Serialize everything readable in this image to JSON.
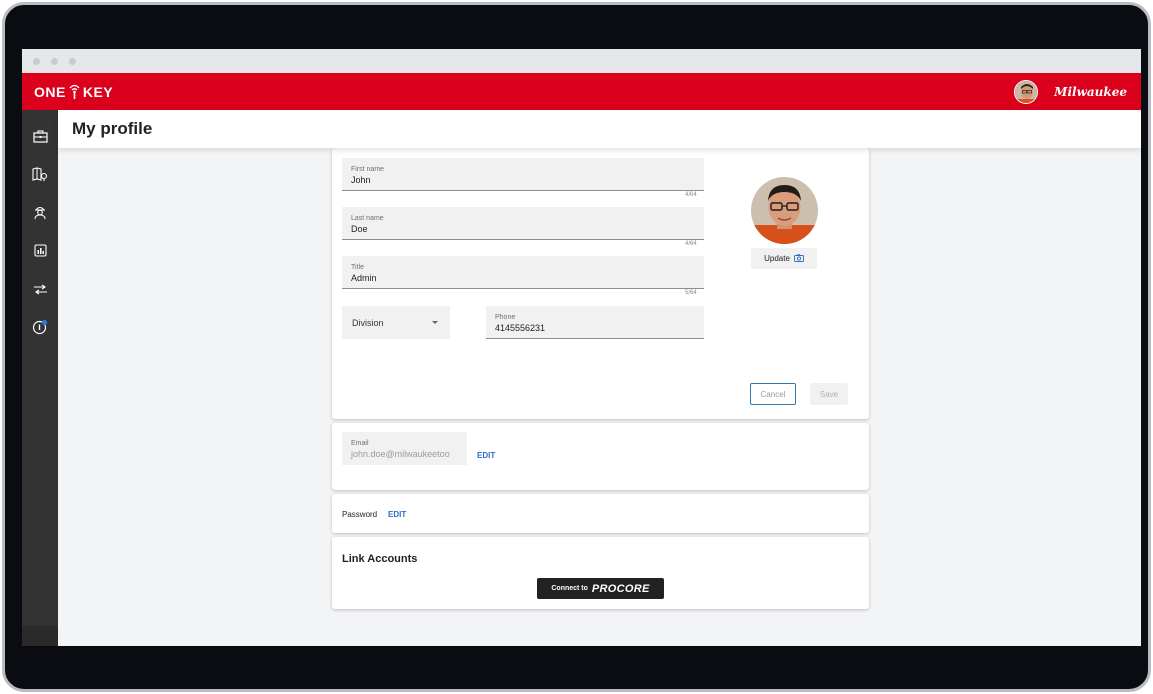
{
  "app": {
    "logo_text_left": "ONE",
    "logo_text_right": "KEY",
    "brand": "Milwaukee"
  },
  "header": {
    "title": "My profile"
  },
  "sidebar": {
    "items": [
      {
        "icon": "toolbox-icon"
      },
      {
        "icon": "map-pin-icon"
      },
      {
        "icon": "worker-icon"
      },
      {
        "icon": "report-icon"
      },
      {
        "icon": "transfer-icon"
      },
      {
        "icon": "info-icon"
      }
    ]
  },
  "profile": {
    "first_name": {
      "label": "First name",
      "value": "John",
      "counter": "4/64"
    },
    "last_name": {
      "label": "Last name",
      "value": "Doe",
      "counter": "4/64"
    },
    "title": {
      "label": "Title",
      "value": "Admin",
      "counter": "5/64"
    },
    "division": {
      "label": "Division"
    },
    "phone": {
      "label": "Phone",
      "value": "4145556231"
    },
    "update_label": "Update",
    "cancel_label": "Cancel",
    "save_label": "Save"
  },
  "email": {
    "label": "Email",
    "value": "john.doe@milwaukeetoo",
    "edit_label": "EDIT"
  },
  "password": {
    "label": "Password",
    "edit_label": "EDIT"
  },
  "link_accounts": {
    "title": "Link Accounts",
    "connect_prefix": "Connect to",
    "connect_brand": "PROCORE"
  },
  "colors": {
    "brand_red": "#db011c",
    "sidebar": "#333333",
    "link_blue": "#2a6fc9"
  }
}
